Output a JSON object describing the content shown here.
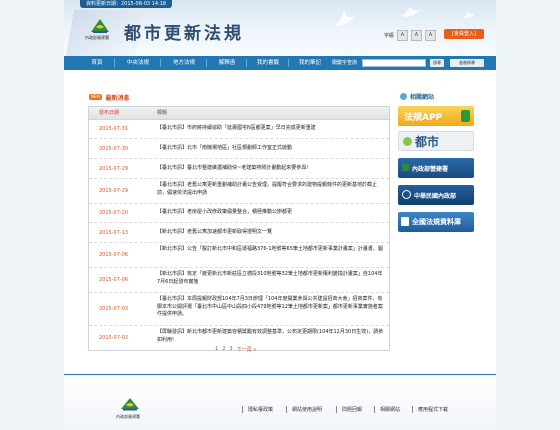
{
  "header": {
    "update_text": "資料更新日期：2015-08-03 14:18",
    "site_title": "都市更新法規",
    "logo_sub": "內政部營建署",
    "font_size_label": "字級",
    "font_sizes": [
      "A",
      "A",
      "A"
    ],
    "member_login": "[會員登入]"
  },
  "nav": {
    "items": [
      "首頁",
      "中央法規",
      "地方法規",
      "解釋函",
      "我的書籤",
      "我的筆記"
    ],
    "search_label": "關鍵字查詢",
    "search_placeholder": "",
    "search_button": "搜尋",
    "advanced_search": "進階搜尋"
  },
  "news": {
    "badge": "NEW",
    "title": "最新消息",
    "col_date": "發布日期",
    "col_title": "標題",
    "rows": [
      {
        "date": "2015-07-31",
        "title": "【臺北市訊】市府將持續協助「延壽國宅N區都更案」早日完成更新重建"
      },
      {
        "date": "2015-07-30",
        "title": "【臺北市訊】北市「南機場地區」社區規劃師工作室正式啟動"
      },
      {
        "date": "2015-07-29",
        "title": "【臺北市訊】臺北市整建維護補助快~老建築熱鬧計畫動起來要參與!"
      },
      {
        "date": "2015-07-29",
        "title": "【臺北市訊】老舊公寓更新重劃補助計畫公告受理，提醒符合要求的建物提報條件的更新基地於截止前，儘速依法提出申請"
      },
      {
        "date": "2015-07-20",
        "title": "【臺北市訊】老房屋小改修政策儘量整合，積極推動公辦都更"
      },
      {
        "date": "2015-07-13",
        "title": "【新北市訊】老舊公寓加速都市更新取得證明文一覽"
      },
      {
        "date": "2015-07-06",
        "title": "【新北市訊】公告「擬訂新北市中和區運福路376-1地號等65筆土地都市更新事業計畫案」計畫書、圖"
      },
      {
        "date": "2015-07-06",
        "title": "【新北市訊】核定「變更新北市新莊區立德段310地號等32筆土地都市更新權利變換計畫案」自104年7月6日起發布實施"
      },
      {
        "date": "2015-07-03",
        "title": "【臺北市訊】本局提報財政部104年7月3日辦理「104年度開業參與公共建設招商大會」招商案件，有關本市公開評選「臺北市中山區中山段四小段479地號等12筆土地都市更新案」都市更新事業實施者案件提供申請。"
      },
      {
        "date": "2015-07-02",
        "title": "【屏縣發訊】新北市都市更新建築容積獎勵有效調整基準，公布定更期限(104年12月30日生效)，請參如利用!"
      }
    ]
  },
  "pagination": [
    "1",
    "2",
    "3",
    "下一頁 »"
  ],
  "related": {
    "title": "相關網站",
    "banners": [
      {
        "label": "法規APP",
        "bg": "#f7c23a",
        "fg": "#ffffff"
      },
      {
        "label": "都市",
        "bg": "#eef1f4",
        "fg": "#2a5c8a"
      },
      {
        "label": "內政部營建署",
        "bg": "#1f5c9a",
        "fg": "#ffffff"
      },
      {
        "label": "中華民國內政部",
        "bg": "#1a4f86",
        "fg": "#ffffff"
      },
      {
        "label": "全國法規資料庫",
        "bg": "#2a6db0",
        "fg": "#ffffff"
      }
    ]
  },
  "footer": {
    "logo_text": "內政部營建署",
    "links": [
      "隱私權政策",
      "網站使用說明",
      "問題回報",
      "相關網站",
      "應用程式下載"
    ]
  },
  "colors": {
    "nav_bg": "#2278b2",
    "accent_orange": "#e85d1a",
    "date_red": "#d05a2a"
  }
}
